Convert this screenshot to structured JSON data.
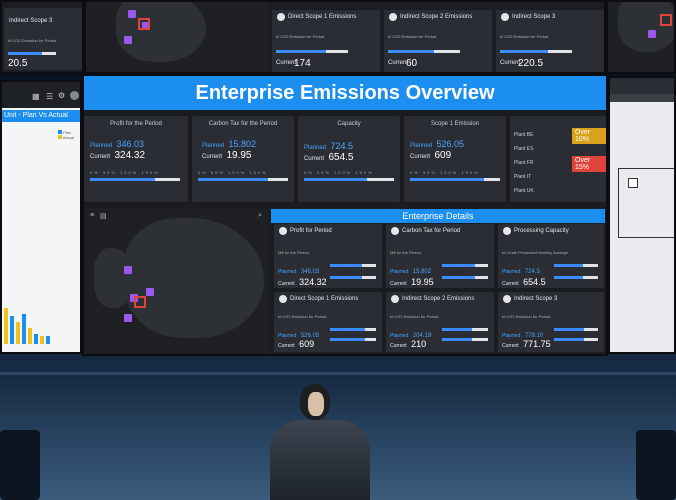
{
  "main": {
    "banner_title": "Enterprise Emissions Overview",
    "kpis": [
      {
        "title": "Profit for the Period",
        "planned_label": "Planned",
        "planned": "346.03",
        "current_label": "Current",
        "current": "324.32",
        "progress": 0.72
      },
      {
        "title": "Carbon Tax for the Period",
        "planned_label": "Planned",
        "planned": "15.802",
        "current_label": "Current",
        "current": "19.95",
        "progress": 0.78
      },
      {
        "title": "Capacity",
        "planned_label": "Planned",
        "planned": "724.5",
        "current_label": "Current",
        "current": "654.5",
        "progress": 0.7
      },
      {
        "title": "Scope 1 Emission",
        "planned_label": "Planned",
        "planned": "526.05",
        "current_label": "Current",
        "current": "609",
        "progress": 0.82
      }
    ],
    "plants": {
      "items": [
        "Plant BE",
        "Plant ES",
        "Plant FR",
        "Plant IT",
        "Plant UK"
      ],
      "alerts": [
        {
          "text": "Over 10%",
          "color": "#d9a21b"
        },
        {
          "text": "Over 15%",
          "color": "#e0433a"
        }
      ]
    },
    "details_title": "Enterprise Details",
    "details": [
      {
        "title": "Profit for Period",
        "sub": "M$ for the Period",
        "planned": "346.03",
        "current": "324.32",
        "progress": 0.7
      },
      {
        "title": "Carbon Tax for Period",
        "sub": "M$ for the Period",
        "planned": "15.802",
        "current": "19.95",
        "progress": 0.72
      },
      {
        "title": "Processing Capacity",
        "sub": "kt Crude Processed Monthly Average",
        "planned": "724.5",
        "current": "654.5",
        "progress": 0.65
      },
      {
        "title": "Direct Scope 1 Emissions",
        "sub": "kt CO2 Emission for Period",
        "planned": "526.05",
        "current": "609",
        "progress": 0.75
      },
      {
        "title": "Indirect Scope 2 Emissions",
        "sub": "kt CO2 Emission for Period",
        "planned": "204.19",
        "current": "210",
        "progress": 0.66
      },
      {
        "title": "Indirect Scope 3",
        "sub": "kt CO2 Emission for Period",
        "planned": "779.10",
        "current": "771.75",
        "progress": 0.68
      }
    ],
    "planned_label": "Planned",
    "current_label": "Current",
    "scale": "0% 50% 100% 150%"
  },
  "top": {
    "cards": [
      {
        "title": "Direct Scope 1 Emissions",
        "sub": "kt CO2 Emission for Period",
        "current_label": "Current",
        "current": "174"
      },
      {
        "title": "Indirect Scope 2 Emissions",
        "sub": "kt CO2 Emission for Period",
        "current_label": "Current",
        "current": "60"
      },
      {
        "title": "Indirect Scope 3",
        "sub": "kt CO2 Emission for Period",
        "current_label": "Current",
        "current": "220.5"
      }
    ],
    "left_title": "Indirect Scope 3",
    "left_value": "20.5"
  },
  "left_screen": {
    "header": "Unit - Plan Vs Actual",
    "legend": [
      "Plan",
      "Actual"
    ]
  }
}
